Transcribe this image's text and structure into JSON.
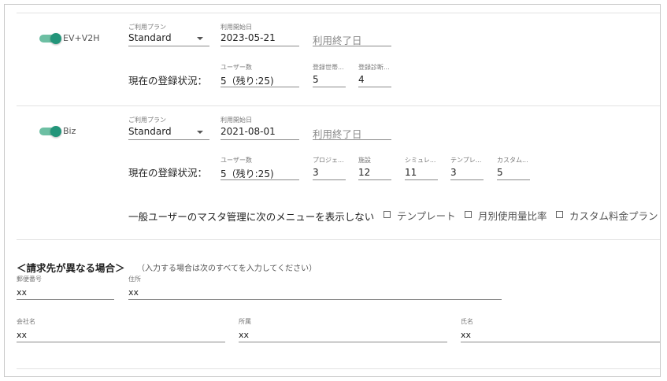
{
  "ev_section": {
    "toggle_label": "EV+V2H",
    "plan_label": "ご利用プラン",
    "plan_value": "Standard",
    "start_label": "利用開始日",
    "start_value": "2023-05-21",
    "end_placeholder": "利用終了日",
    "status_label": "現在の登録状況：",
    "fields": [
      {
        "label": "ユーザー数",
        "value": "5（残り:25)"
      },
      {
        "label": "登録世帯...",
        "value": "5"
      },
      {
        "label": "登録診断...",
        "value": "4"
      }
    ]
  },
  "biz_section": {
    "toggle_label": "Biz",
    "plan_label": "ご利用プラン",
    "plan_value": "Standard",
    "start_label": "利用開始日",
    "start_value": "2021-08-01",
    "end_placeholder": "利用終了日",
    "status_label": "現在の登録状況：",
    "fields": [
      {
        "label": "ユーザー数",
        "value": "5（残り:25)"
      },
      {
        "label": "プロジェ...",
        "value": "3"
      },
      {
        "label": "施設",
        "value": "12"
      },
      {
        "label": "シミュレ...",
        "value": "11"
      },
      {
        "label": "テンプレ...",
        "value": "3"
      },
      {
        "label": "カスタム...",
        "value": "5"
      }
    ],
    "menu_hide_label": "一般ユーザーのマスタ管理に次のメニューを表示しない",
    "checkboxes": [
      {
        "label": "テンプレート"
      },
      {
        "label": "月別使用量比率"
      },
      {
        "label": "カスタム料金プラン"
      }
    ]
  },
  "billing": {
    "heading": "＜請求先が異なる場合＞",
    "note": "（入力する場合は次のすべてを入力してください）",
    "postal_label": "郵便番号",
    "postal_value": "xx",
    "address_label": "住所",
    "address_value": "xx",
    "company_label": "会社名",
    "company_value": "xx",
    "dept_label": "所属",
    "dept_value": "xx",
    "name_label": "氏名",
    "name_value": "xx"
  },
  "colors": {
    "toggle_track": "#6dbfa3",
    "toggle_knob": "#23957a"
  }
}
